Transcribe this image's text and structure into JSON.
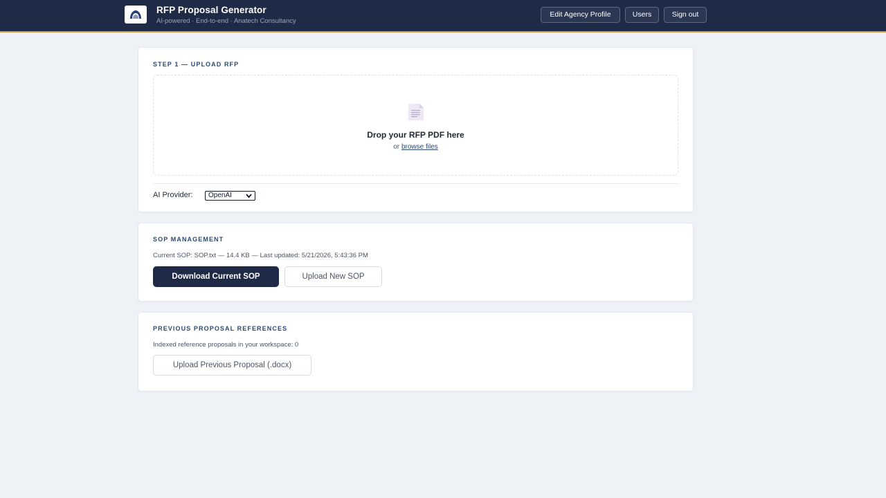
{
  "header": {
    "title": "RFP Proposal Generator",
    "subtitle": "AI-powered · End-to-end · Anatech Consultancy",
    "buttons": {
      "edit_profile": "Edit Agency Profile",
      "users": "Users",
      "sign_out": "Sign out"
    }
  },
  "upload": {
    "section_title": "STEP 1 — UPLOAD RFP",
    "drop_title": "Drop your RFP PDF here",
    "drop_or": "or",
    "browse_label": "browse files",
    "provider_label": "AI Provider:",
    "provider_selected": "OpenAI"
  },
  "sop": {
    "section_title": "SOP MANAGEMENT",
    "current_info": "Current SOP: SOP.txt — 14.4 KB — Last updated: 5/21/2026, 5:43:36 PM",
    "download_label": "Download Current SOP",
    "upload_label": "Upload New SOP"
  },
  "references": {
    "section_title": "PREVIOUS PROPOSAL REFERENCES",
    "indexed_info": "Indexed reference proposals in your workspace: 0",
    "upload_label": "Upload Previous Proposal (.docx)"
  },
  "colors": {
    "header_bg": "#1e2a46",
    "accent_gold": "#c9a24a",
    "section_title": "#2b4a73",
    "page_bg": "#eef2f7"
  },
  "icons": {
    "logo": "agency-logo-icon",
    "document": "document-icon",
    "select_chevron": "chevron-down-icon"
  }
}
